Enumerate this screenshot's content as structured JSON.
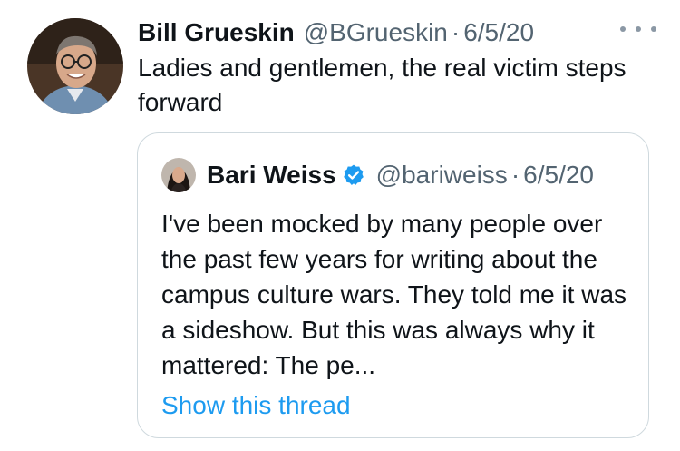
{
  "tweet": {
    "author_name": "Bill Grueskin",
    "author_handle": "@BGrueskin",
    "separator": "·",
    "date": "6/5/20",
    "text": "Ladies and gentlemen, the real victim steps forward",
    "more_icon": "more-horizontal-icon"
  },
  "quoted_tweet": {
    "author_name": "Bari Weiss",
    "verified_icon": "verified-badge-icon",
    "author_handle": "@bariweiss",
    "separator": "·",
    "date": "6/5/20",
    "text": "I've been mocked by many people over the past few years for writing about the campus culture wars. They told me it was a sideshow. But this was always why it mattered: The pe...",
    "show_thread_label": "Show this thread"
  },
  "colors": {
    "text_primary": "#0f1419",
    "text_secondary": "#536471",
    "link": "#1d9bf0",
    "border": "#cfd9de"
  }
}
